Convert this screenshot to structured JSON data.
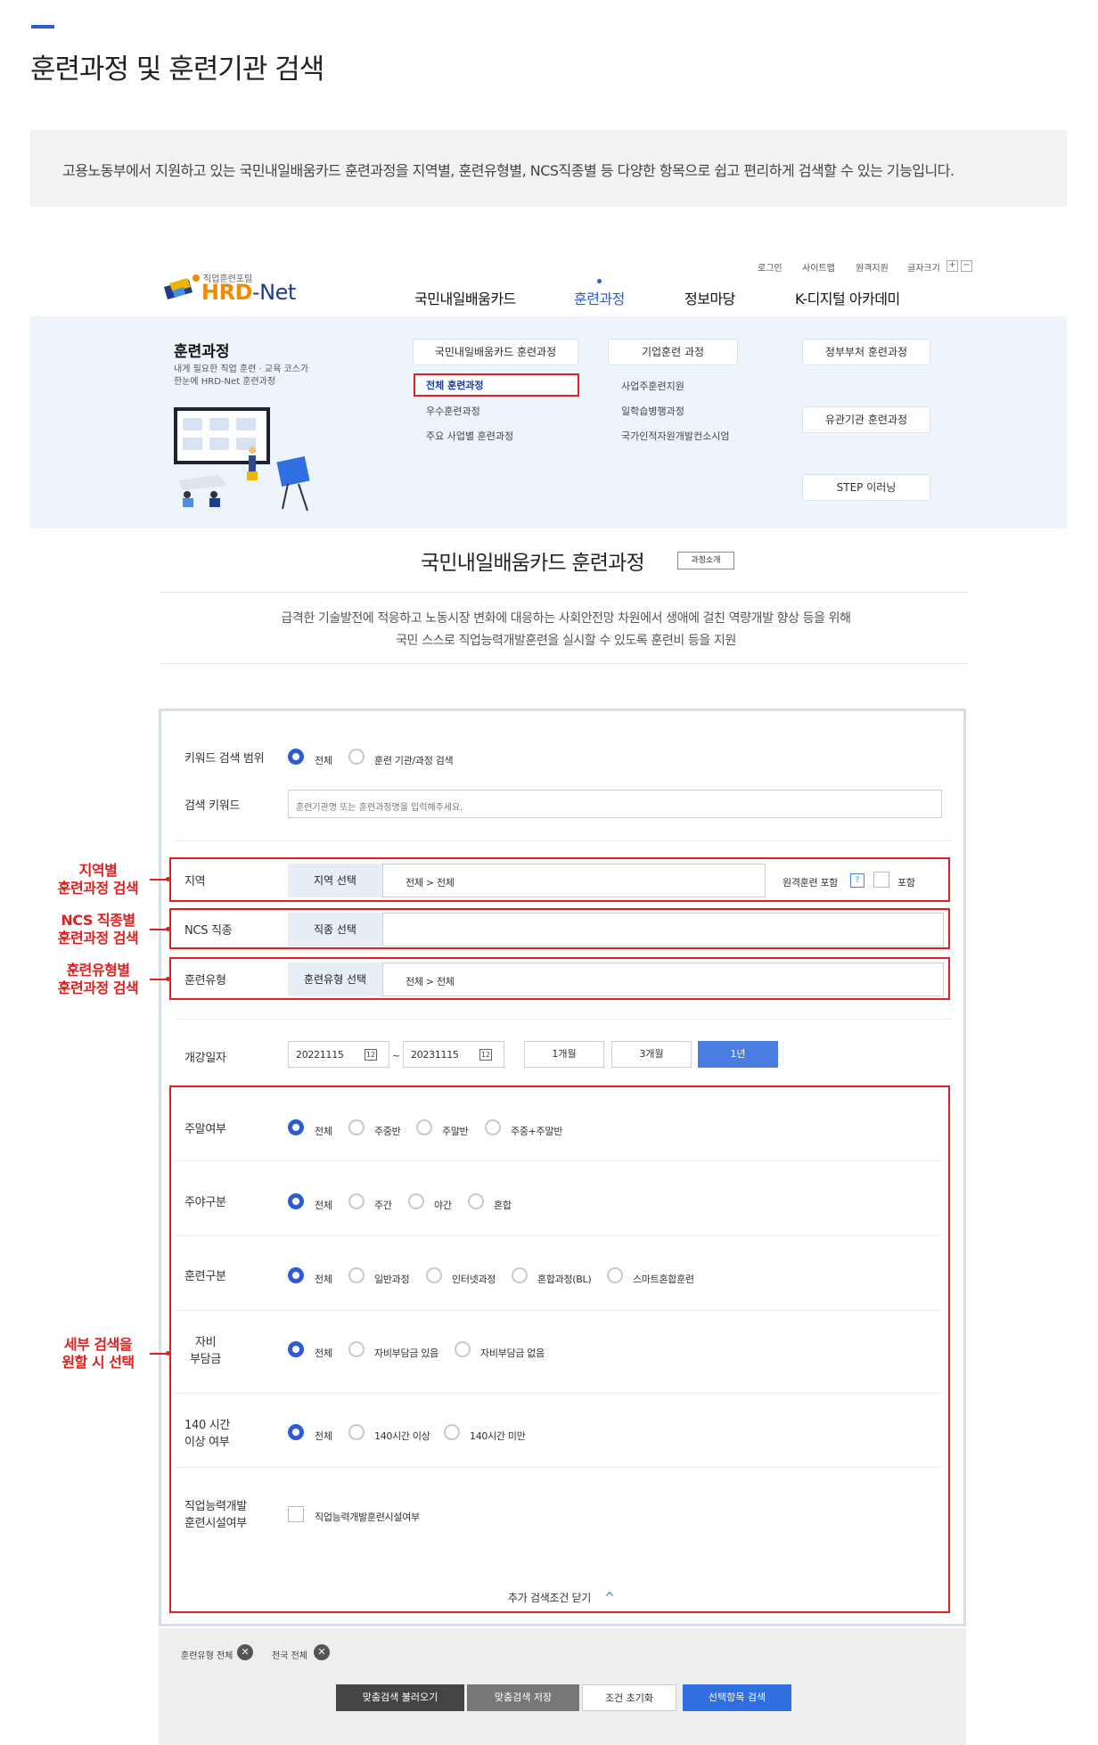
{
  "page": {
    "title": "훈련과정 및 훈련기관 검색",
    "intro": "고용노동부에서 지원하고 있는 국민내일배움카드 훈련과정을 지역별, 훈련유형별, NCS직종별 등 다양한 항목으로 쉽고 편리하게 검색할 수 있는 기능입니다."
  },
  "header": {
    "util": [
      "로그인",
      "사이트맵",
      "원격지원",
      "글자크기"
    ],
    "font_plus": "+",
    "font_minus": "−",
    "logo_sub": "직업훈련포털",
    "logo_main_a": "HRD",
    "logo_main_b": "-Net",
    "nav": [
      "국민내일배움카드",
      "훈련과정",
      "정보마당",
      "K-디지털 아카데미"
    ]
  },
  "mega": {
    "title": "훈련과정",
    "desc1": "내게 필요한 직업 훈련 · 교육 코스가",
    "desc2": "한눈에 HRD-Net 훈련과정",
    "col1_title": "국민내일배움카드 훈련과정",
    "col1_items": [
      "전체 훈련과정",
      "우수훈련과정",
      "주요 사업별 훈련과정"
    ],
    "col2_title": "기업훈련 과정",
    "col2_items": [
      "사업주훈련지원",
      "일학습병행과정",
      "국가인적자원개발컨소시엄"
    ],
    "col3": [
      "정부부처 훈련과정",
      "유관기관 훈련과정",
      "STEP 이러닝"
    ]
  },
  "section": {
    "title": "국민내일배움카드 훈련과정",
    "badge": "과정소개",
    "desc1": "급격한 기술발전에 적응하고 노동시장 변화에 대응하는 사회안전망 차원에서 생애에 걸친 역량개발 향상 등을 위해",
    "desc2": "국민 스스로 직업능력개발훈련을 실시할 수 있도록 훈련비 등을 지원"
  },
  "search": {
    "keyword_scope_label": "키워드 검색 범위",
    "keyword_scope_options": [
      "전체",
      "훈련 기관/과정 검색"
    ],
    "keyword_label": "검색 키워드",
    "keyword_placeholder": "훈련기관명 또는 훈련과정명을 입력해주세요.",
    "region_label": "지역",
    "region_button": "지역 선택",
    "region_value": "전체 > 전체",
    "remote_label": "원격훈련 포함",
    "remote_help": "?",
    "remote_check": "포함",
    "ncs_label": "NCS 직종",
    "ncs_button": "직종 선택",
    "type_label": "훈련유형",
    "type_button": "훈련유형 선택",
    "type_value": "전체 > 전체",
    "date_label": "개강일자",
    "date_start": "20221115",
    "date_sep": "~",
    "date_end": "20231115",
    "cal_icon": "12",
    "periods": [
      "1개월",
      "3개월",
      "1년"
    ],
    "weekend_label": "주말여부",
    "weekend_options": [
      "전체",
      "주중반",
      "주말반",
      "주중+주말반"
    ],
    "daynight_label": "주야구분",
    "daynight_options": [
      "전체",
      "주간",
      "야간",
      "혼합"
    ],
    "course_label": "훈련구분",
    "course_options": [
      "전체",
      "일반과정",
      "인터넷과정",
      "혼합과정(BL)",
      "스마트혼합훈련"
    ],
    "selfpay_label1": "자비",
    "selfpay_label2": "부담금",
    "selfpay_options": [
      "전체",
      "자비부담금 있음",
      "자비부담금 없음"
    ],
    "hours_label1": "140 시간",
    "hours_label2": "이상 여부",
    "hours_options": [
      "전체",
      "140시간 이상",
      "140시간 미만"
    ],
    "facility_label1": "직업능력개발",
    "facility_label2": "훈련시설여부",
    "facility_check": "직업능력개발훈련시설여부",
    "close_more": "추가 검색조건 닫기",
    "close_icon": "^"
  },
  "annotations": {
    "region1": "지역별",
    "region2": "훈련과정 검색",
    "ncs1": "NCS 직종별",
    "ncs2": "훈련과정 검색",
    "type1": "훈련유형별",
    "type2": "훈련과정 검색",
    "detail1": "세부 검색을",
    "detail2": "원할 시 선택"
  },
  "footer": {
    "tags": [
      "훈련유형 전체",
      "전국 전체"
    ],
    "tag_x": "✕",
    "buttons": [
      "맞춤검색 불러오기",
      "맞춤검색 저장",
      "조건 초기화",
      "선택항목 검색"
    ]
  },
  "colors": {
    "accent": "#2f5bd5",
    "annotation_red": "#e02020",
    "search_blue": "#2f6fe0",
    "dark_button": "#444444"
  }
}
